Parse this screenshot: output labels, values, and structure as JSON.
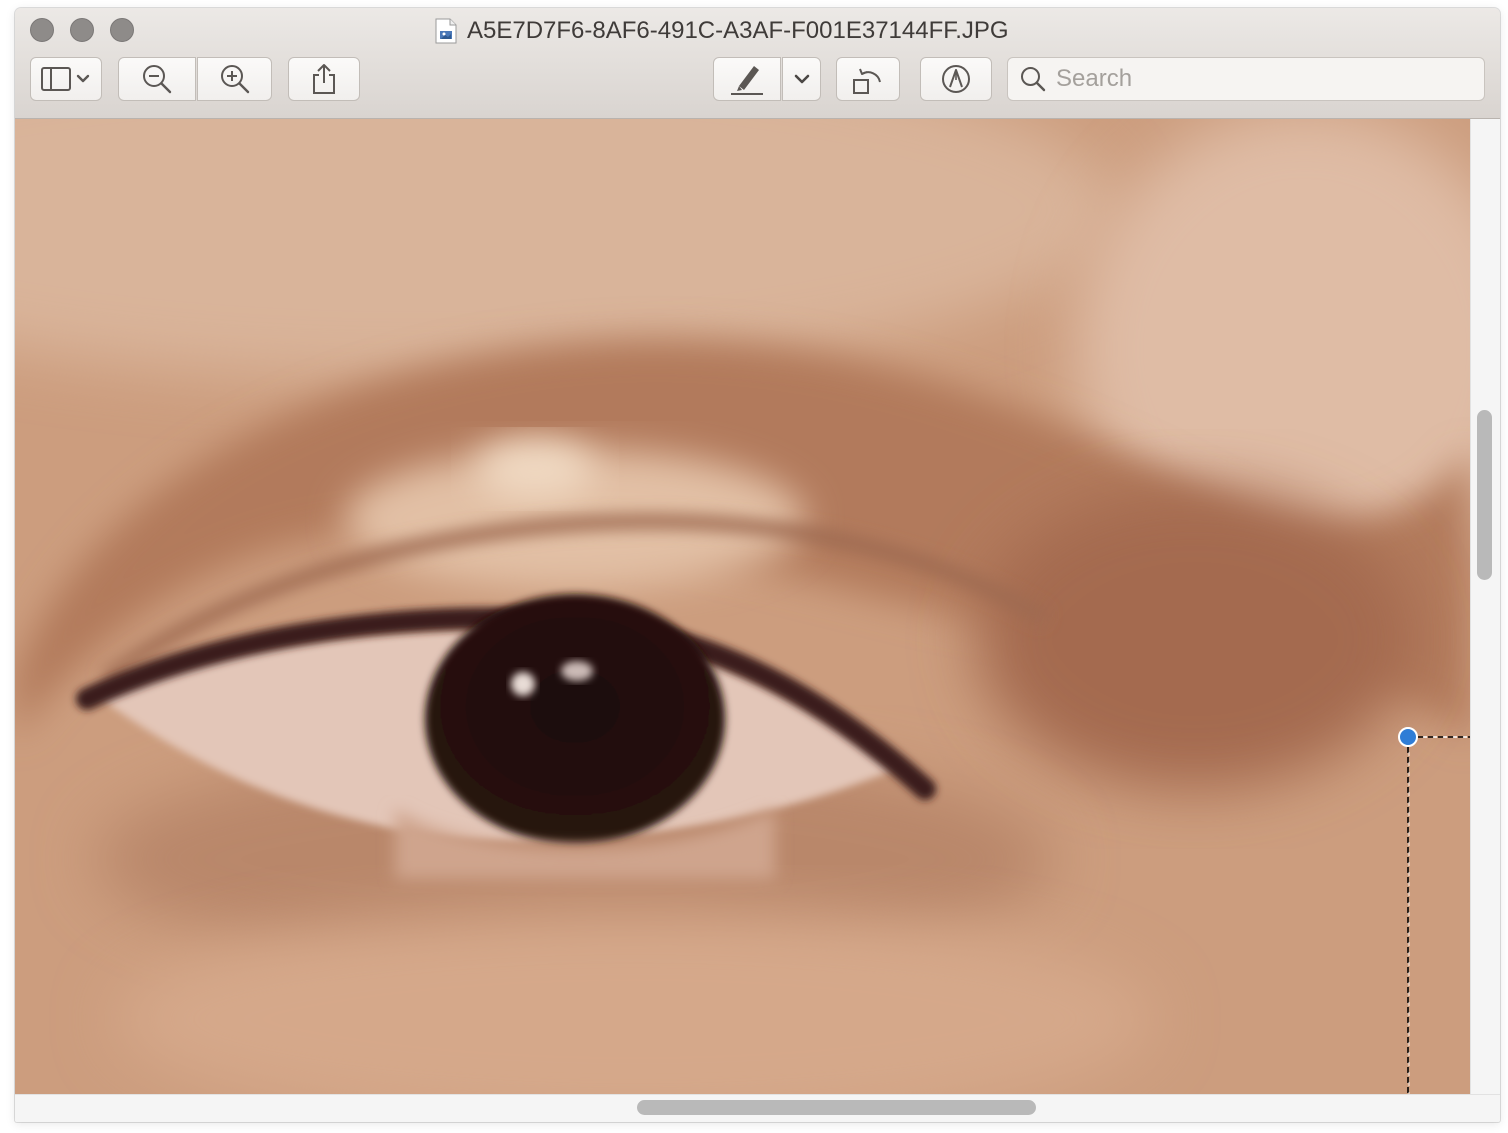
{
  "window": {
    "title": "A5E7D7F6-8AF6-491C-A3AF-F001E37144FF.JPG"
  },
  "toolbar": {
    "buttons": [
      {
        "name": "sidebar-toggle-button",
        "icon": "sidebar-icon"
      },
      {
        "name": "zoom-out-button",
        "icon": "zoom-out-icon"
      },
      {
        "name": "zoom-in-button",
        "icon": "zoom-in-icon"
      },
      {
        "name": "share-button",
        "icon": "share-icon"
      },
      {
        "name": "highlight-button",
        "icon": "highlighter-icon"
      },
      {
        "name": "highlight-menu-button",
        "icon": "chevron-down-icon"
      },
      {
        "name": "rotate-button",
        "icon": "rotate-left-icon"
      },
      {
        "name": "markup-button",
        "icon": "markup-pen-icon"
      }
    ],
    "search": {
      "placeholder": "Search",
      "value": ""
    }
  },
  "colors": {
    "selection_handle": "#2f7dd6",
    "skin_base": "#c99a7a"
  }
}
